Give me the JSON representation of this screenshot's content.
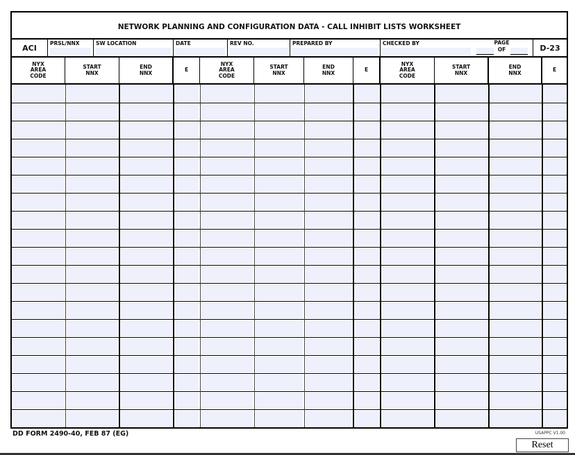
{
  "form": {
    "title": "NETWORK PLANNING AND CONFIGURATION DATA - CALL INHIBIT LISTS WORKSHEET",
    "aci_label": "ACI",
    "form_code": "D-23",
    "info_fields": [
      {
        "label": "PRSL/NNX",
        "value": ""
      },
      {
        "label": "SW LOCATION",
        "value": ""
      },
      {
        "label": "DATE",
        "value": ""
      },
      {
        "label": "REV NO.",
        "value": ""
      },
      {
        "label": "PREPARED BY",
        "value": ""
      },
      {
        "label": "CHECKED BY",
        "value": ""
      }
    ],
    "page": {
      "label": "PAGE",
      "of_label": "OF",
      "page_value": "",
      "of_value": ""
    },
    "columns": [
      "NYX\nAREA\nCODE",
      "START\nNNX",
      "END\nNNX",
      "E",
      "NYX\nAREA\nCODE",
      "START\nNNX",
      "END\nNNX",
      "E",
      "NYX\nAREA\nCODE",
      "START\nNNX",
      "END\nNNX",
      "E"
    ],
    "row_count": 19,
    "footer": {
      "form_id": "DD FORM 2490-40, FEB 87 (EG)",
      "version": "USAPPC V1.00",
      "reset_label": "Reset"
    },
    "colors": {
      "field_fill": "#eef0fb",
      "border": "#000000"
    }
  }
}
